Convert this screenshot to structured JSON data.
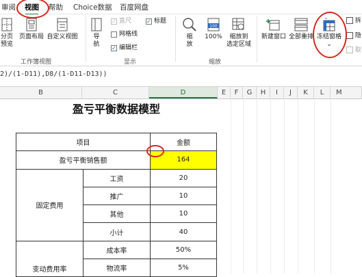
{
  "tabs": [
    {
      "label": "审阅"
    },
    {
      "label": "视图"
    },
    {
      "label": "帮助"
    },
    {
      "label": "Choice数据"
    },
    {
      "label": "百度网盘"
    }
  ],
  "ribbon": {
    "workbook_views": {
      "buttons": [
        {
          "label_line1": "分页",
          "label_line2": "预览"
        },
        {
          "label_line1": "页面布局",
          "label_line2": ""
        },
        {
          "label_line1": "自定义视图",
          "label_line2": ""
        }
      ],
      "group_label": "工作簿视图"
    },
    "show": {
      "nav_label_line1": "导",
      "nav_label_line2": "航",
      "checkboxes": [
        {
          "label": "直尺",
          "checked": true,
          "disabled": true
        },
        {
          "label": "网格线",
          "checked": false,
          "disabled": false
        },
        {
          "label": "编辑栏",
          "checked": true,
          "disabled": false
        },
        {
          "label": "标题",
          "checked": true,
          "disabled": false
        }
      ],
      "check_mark": "✓",
      "group_label": "显示"
    },
    "zoom": {
      "buttons": [
        {
          "label_line1": "缩",
          "label_line2": "放"
        },
        {
          "label_line1": "100%",
          "label_line2": ""
        },
        {
          "label_line1": "缩放到",
          "label_line2": "选定区域"
        }
      ],
      "icon_100_text": "100",
      "group_label": "缩放"
    },
    "window": {
      "buttons": [
        {
          "label_line1": "新建窗口"
        },
        {
          "label_line1": "全部重排"
        },
        {
          "label_line1": "冻结窗格",
          "label_line2": "⌄"
        }
      ],
      "side_items": [
        {
          "label": "拆"
        },
        {
          "label": "隐"
        },
        {
          "label": "取"
        }
      ]
    }
  },
  "formula_bar": {
    "text": "2)/(1-D11),D8/(1-D11-D13))"
  },
  "columns": [
    "B",
    "C",
    "D",
    "E",
    "F",
    "G",
    "H",
    "I",
    "J",
    "K",
    "L",
    "M"
  ],
  "selected_column": "D",
  "sheet": {
    "title": "盈亏平衡数据模型",
    "header": {
      "item": "项目",
      "amount": "金额"
    },
    "breakeven": {
      "label": "盈亏平衡销售额",
      "value": "164"
    },
    "fixed_costs": {
      "group_label": "固定费用",
      "rows": [
        {
          "label": "工资",
          "value": "20"
        },
        {
          "label": "推广",
          "value": "10"
        },
        {
          "label": "其他",
          "value": "10"
        },
        {
          "label": "小计",
          "value": "40"
        }
      ]
    },
    "variable_costs": {
      "group_label": "变动费用率",
      "rows": [
        {
          "label": "成本率",
          "value": "50%"
        },
        {
          "label": "物流率",
          "value": "5%"
        }
      ]
    }
  },
  "colors": {
    "accent": "#217346",
    "highlight": "#ffff00",
    "annotation": "#d9261c"
  }
}
